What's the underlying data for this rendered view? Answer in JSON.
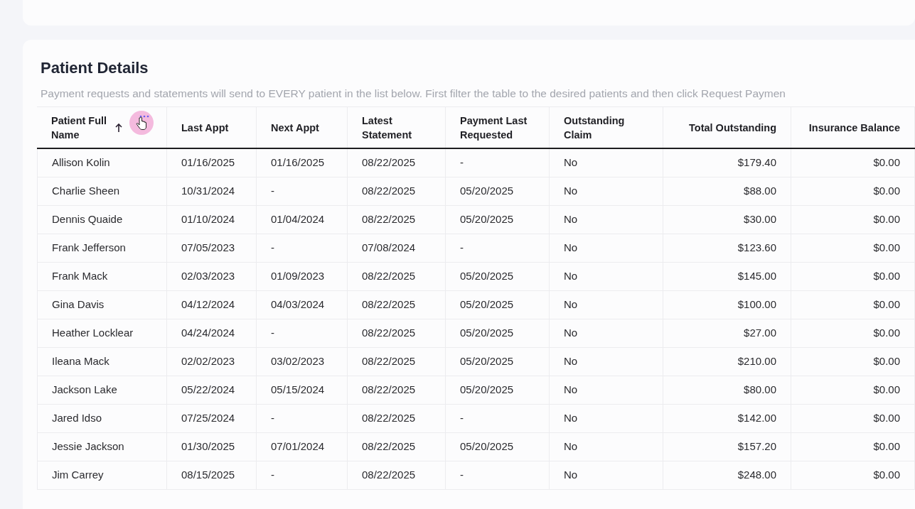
{
  "section": {
    "title": "Patient Details",
    "description": "Payment requests and statements will send to EVERY patient in the list below. First filter the table to the desired patients and then click Request Paymen"
  },
  "table": {
    "columns": [
      {
        "label": "Patient Full Name",
        "kind": "text",
        "sorted": true,
        "hovered": true
      },
      {
        "label": "Last Appt",
        "kind": "text",
        "sorted": false,
        "hovered": false
      },
      {
        "label": "Next Appt",
        "kind": "text",
        "sorted": false,
        "hovered": false
      },
      {
        "label": "Latest Statement",
        "kind": "text",
        "sorted": false,
        "hovered": false
      },
      {
        "label": "Payment Last Requested",
        "kind": "text",
        "sorted": false,
        "hovered": false
      },
      {
        "label": "Outstanding Claim",
        "kind": "text",
        "sorted": false,
        "hovered": false
      },
      {
        "label": "Total Outstanding",
        "kind": "money",
        "sorted": false,
        "hovered": false
      },
      {
        "label": "Insurance Balance",
        "kind": "money",
        "sorted": false,
        "hovered": false
      }
    ],
    "rows": [
      [
        "Allison Kolin",
        "01/16/2025",
        "01/16/2025",
        "08/22/2025",
        "-",
        "No",
        "$179.40",
        "$0.00"
      ],
      [
        "Charlie Sheen",
        "10/31/2024",
        "-",
        "08/22/2025",
        "05/20/2025",
        "No",
        "$88.00",
        "$0.00"
      ],
      [
        "Dennis Quaide",
        "01/10/2024",
        "01/04/2024",
        "08/22/2025",
        "05/20/2025",
        "No",
        "$30.00",
        "$0.00"
      ],
      [
        "Frank Jefferson",
        "07/05/2023",
        "-",
        "07/08/2024",
        "-",
        "No",
        "$123.60",
        "$0.00"
      ],
      [
        "Frank Mack",
        "02/03/2023",
        "01/09/2023",
        "08/22/2025",
        "05/20/2025",
        "No",
        "$145.00",
        "$0.00"
      ],
      [
        "Gina Davis",
        "04/12/2024",
        "04/03/2024",
        "08/22/2025",
        "05/20/2025",
        "No",
        "$100.00",
        "$0.00"
      ],
      [
        "Heather Locklear",
        "04/24/2024",
        "-",
        "08/22/2025",
        "05/20/2025",
        "No",
        "$27.00",
        "$0.00"
      ],
      [
        "Ileana Mack",
        "02/02/2023",
        "03/02/2023",
        "08/22/2025",
        "05/20/2025",
        "No",
        "$210.00",
        "$0.00"
      ],
      [
        "Jackson Lake",
        "05/22/2024",
        "05/15/2024",
        "08/22/2025",
        "05/20/2025",
        "No",
        "$80.00",
        "$0.00"
      ],
      [
        "Jared Idso",
        "07/25/2024",
        "-",
        "08/22/2025",
        "-",
        "No",
        "$142.00",
        "$0.00"
      ],
      [
        "Jessie Jackson",
        "01/30/2025",
        "07/01/2024",
        "08/22/2025",
        "05/20/2025",
        "No",
        "$157.20",
        "$0.00"
      ],
      [
        "Jim Carrey",
        "08/15/2025",
        "-",
        "08/22/2025",
        "-",
        "No",
        "$248.00",
        "$0.00"
      ]
    ]
  }
}
